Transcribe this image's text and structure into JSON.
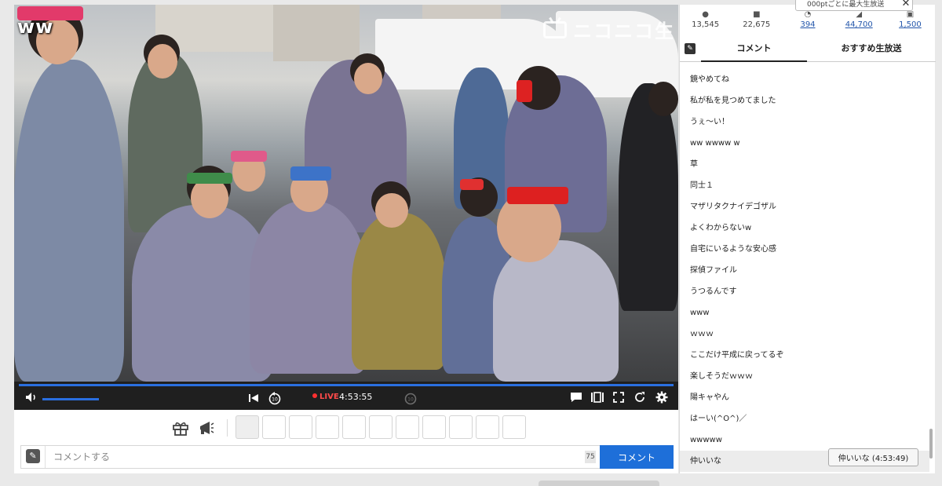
{
  "video": {
    "overlay_text": "ww",
    "watermark": "ニコニコ生"
  },
  "controls": {
    "volume_icon": "speaker-icon",
    "live_label": "LIVE",
    "elapsed": "4:53:55"
  },
  "stats": [
    {
      "icon": "viewers-icon",
      "value": "13,545",
      "link": false
    },
    {
      "icon": "comments-icon",
      "value": "22,675",
      "link": false
    },
    {
      "icon": "points-icon",
      "value": "394",
      "link": true
    },
    {
      "icon": "ad-icon",
      "value": "44,700",
      "link": true
    },
    {
      "icon": "gift-icon",
      "value": "1,500",
      "link": true
    }
  ],
  "notice": "000ptごとに最大生放送",
  "tabs": {
    "comments": "コメント",
    "recommended": "おすすめ生放送"
  },
  "comments": [
    "鏡やめてね",
    "私が私を見つめてました",
    "うぇ～い！",
    "ww wwww w",
    "草",
    "同士１",
    "マザリタクナイデゴザル",
    "よくわからないw",
    "自宅にいるような安心感",
    "探偵ファイル",
    "うつるんです",
    "www",
    "ｗｗｗ",
    "ここだけ平成に戻ってるぞ",
    "楽しそうだｗｗｗ",
    "陽キャやん",
    "はーい(^O^)／",
    "wwwww",
    "仲いいな"
  ],
  "jump_button": "仲いいな (4:53:49)",
  "comment_box": {
    "placeholder": "コメントする",
    "char_count": "75",
    "submit_label": "コメント"
  }
}
